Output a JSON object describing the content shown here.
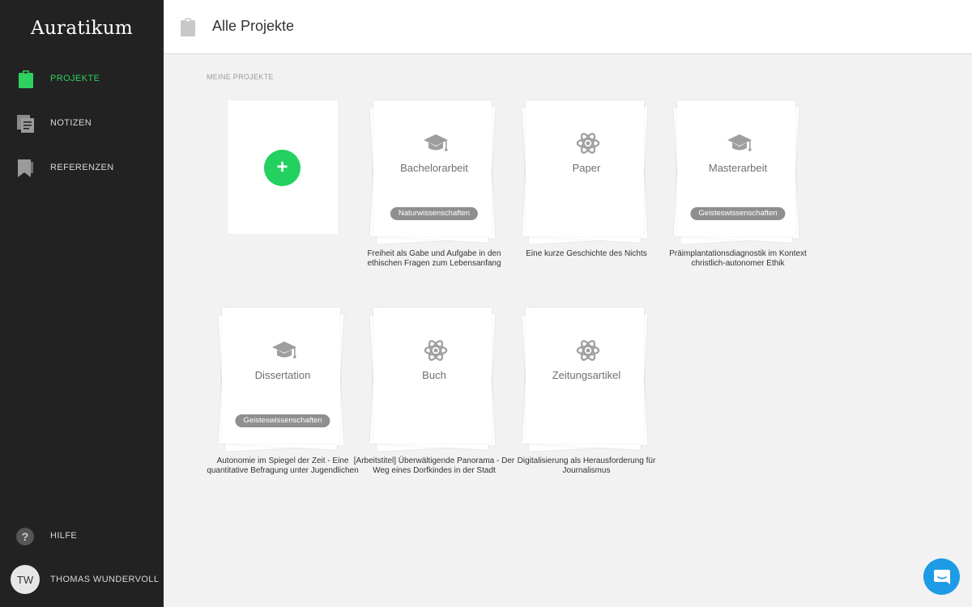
{
  "brand": "Auratikum",
  "nav": {
    "projekte": "PROJEKTE",
    "notizen": "NOTIZEN",
    "referenzen": "REFERENZEN",
    "hilfe": "HILFE",
    "help_glyph": "?"
  },
  "user": {
    "initials": "TW",
    "name": "THOMAS WUNDERVOLL"
  },
  "header": {
    "title": "Alle Projekte"
  },
  "section": {
    "label": "MEINE PROJEKTE"
  },
  "new_project": {
    "icon": "+"
  },
  "projects": [
    {
      "type": "Bachelorarbeit",
      "icon": "graduation-cap-icon",
      "badge": "Naturwissenschaften",
      "caption": "Freiheit als Gabe und Aufgabe in den ethischen Fragen zum Lebensanfang"
    },
    {
      "type": "Paper",
      "icon": "atom-icon",
      "badge": "",
      "caption": "Eine kurze Geschichte des Nichts"
    },
    {
      "type": "Masterarbeit",
      "icon": "graduation-cap-icon",
      "badge": "Geisteswissenschaften",
      "caption": "Präimplantationsdiagnostik im Kontext christlich-autonomer Ethik"
    },
    {
      "type": "Dissertation",
      "icon": "graduation-cap-icon",
      "badge": "Geisteswissenschaften",
      "caption": "Autonomie im Spiegel der Zeit - Eine quantitative Befragung unter Jugendlichen"
    },
    {
      "type": "Buch",
      "icon": "atom-icon",
      "badge": "",
      "caption": "[Arbeitstitel] Überwältigende Panorama - Der Weg eines Dorfkindes in der Stadt"
    },
    {
      "type": "Zeitungsartikel",
      "icon": "atom-icon",
      "badge": "",
      "caption": "Digitalisierung als Herausforderung für Journalismus"
    }
  ],
  "colors": {
    "sidebar": "#222222",
    "accent": "#22d160",
    "chat": "#1e9be6",
    "badge": "#8f8f8f"
  }
}
